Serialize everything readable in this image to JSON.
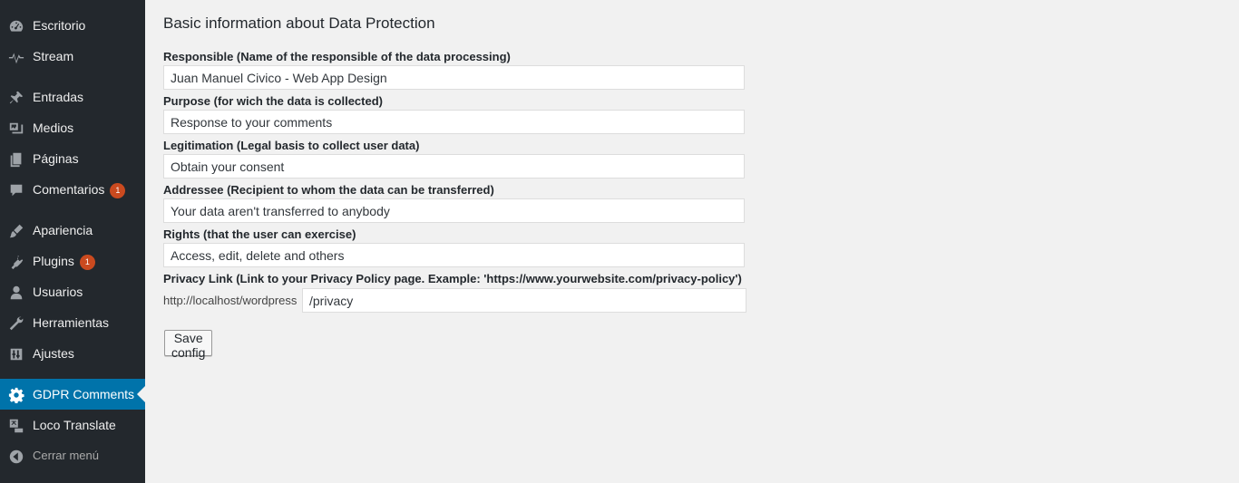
{
  "sidebar": {
    "items": [
      {
        "label": "Escritorio",
        "icon": "dashboard-icon"
      },
      {
        "label": "Stream",
        "icon": "stream-icon"
      },
      {
        "label": "Entradas",
        "icon": "pin-icon"
      },
      {
        "label": "Medios",
        "icon": "media-icon"
      },
      {
        "label": "Páginas",
        "icon": "pages-icon"
      },
      {
        "label": "Comentarios",
        "icon": "comments-icon",
        "badge": "1"
      },
      {
        "label": "Apariencia",
        "icon": "appearance-icon"
      },
      {
        "label": "Plugins",
        "icon": "plugins-icon",
        "badge": "1"
      },
      {
        "label": "Usuarios",
        "icon": "users-icon"
      },
      {
        "label": "Herramientas",
        "icon": "tools-icon"
      },
      {
        "label": "Ajustes",
        "icon": "settings-icon"
      },
      {
        "label": "GDPR Comments",
        "icon": "gear-icon",
        "active": true
      },
      {
        "label": "Loco Translate",
        "icon": "translate-icon"
      },
      {
        "label": "Cerrar menú",
        "icon": "collapse-icon"
      }
    ]
  },
  "main": {
    "title": "Basic information about Data Protection",
    "fields": [
      {
        "label": "Responsible (Name of the responsible of the data processing)",
        "value": "Juan Manuel Civico - Web App Design"
      },
      {
        "label": "Purpose (for wich the data is collected)",
        "value": "Response to your comments"
      },
      {
        "label": "Legitimation (Legal basis to collect user data)",
        "value": "Obtain your consent"
      },
      {
        "label": "Addressee (Recipient to whom the data can be transferred)",
        "value": "Your data aren't transferred to anybody"
      },
      {
        "label": "Rights (that the user can exercise)",
        "value": "Access, edit, delete and others"
      }
    ],
    "privacy": {
      "label": "Privacy Link (Link to your Privacy Policy page. Example: 'https://www.yourwebsite.com/privacy-policy')",
      "prefix": "http://localhost/wordpress",
      "value": "/privacy"
    },
    "save_label": "Save config"
  },
  "colors": {
    "sidebar_bg": "#23282d",
    "active_bg": "#0073aa",
    "badge": "#ca4a1f",
    "page_bg": "#f1f1f1"
  }
}
